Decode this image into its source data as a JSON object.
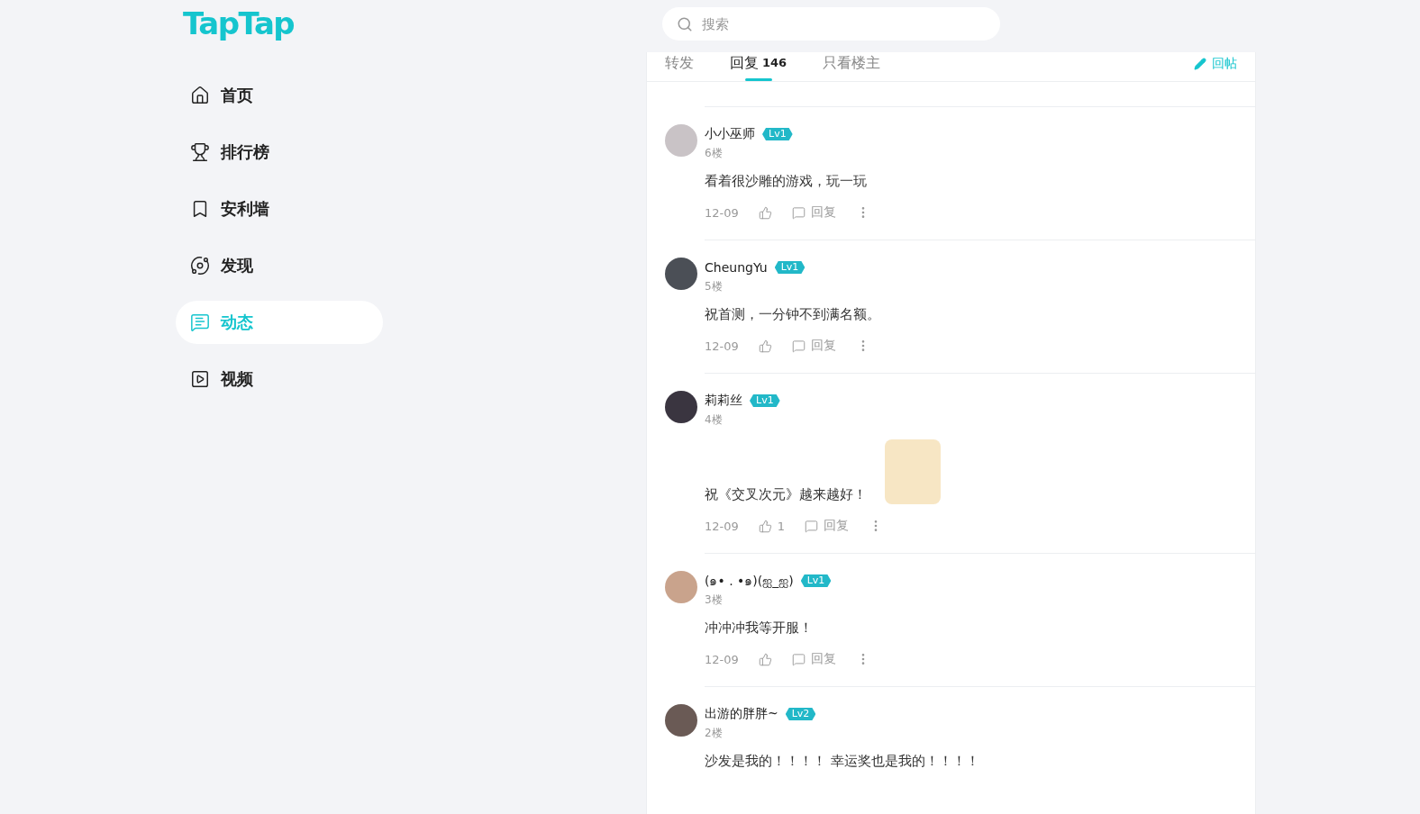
{
  "logo": "TapTap",
  "nav": [
    {
      "label": "首页",
      "selected": false
    },
    {
      "label": "排行榜",
      "selected": false
    },
    {
      "label": "安利墙",
      "selected": false
    },
    {
      "label": "发现",
      "selected": false
    },
    {
      "label": "动态",
      "selected": true
    },
    {
      "label": "视频",
      "selected": false
    }
  ],
  "search": {
    "placeholder": "搜索"
  },
  "tabs": [
    {
      "label": "转发",
      "selected": false
    },
    {
      "label": "回复",
      "count": "146",
      "selected": true
    },
    {
      "label": "只看楼主",
      "selected": false
    }
  ],
  "post_button": "回帖",
  "comments": [
    {
      "name": "小小巫师",
      "level": "Lv1",
      "floor": "6楼",
      "text": "看着很沙雕的游戏，玩一玩",
      "sticker": false,
      "date": "12-09",
      "reply": "回复"
    },
    {
      "name": "CheungYu",
      "level": "Lv1",
      "floor": "5楼",
      "text": "祝首测，一分钟不到满名额。",
      "sticker": false,
      "date": "12-09",
      "reply": "回复"
    },
    {
      "name": "莉莉丝",
      "level": "Lv1",
      "floor": "4楼",
      "text": "祝《交叉次元》越来越好！",
      "sticker": true,
      "date": "12-09",
      "likes": "1",
      "reply": "回复"
    },
    {
      "name": "(๑• . •๑)(ஐ_ஐ)",
      "level": "Lv1",
      "floor": "3楼",
      "text": "冲冲冲我等开服！",
      "sticker": false,
      "date": "12-09",
      "reply": "回复"
    },
    {
      "name": "出游的胖胖~",
      "level": "Lv2",
      "floor": "2楼",
      "text": "沙发是我的！！！！ 幸运奖也是我的！！！！",
      "sticker": false
    }
  ]
}
